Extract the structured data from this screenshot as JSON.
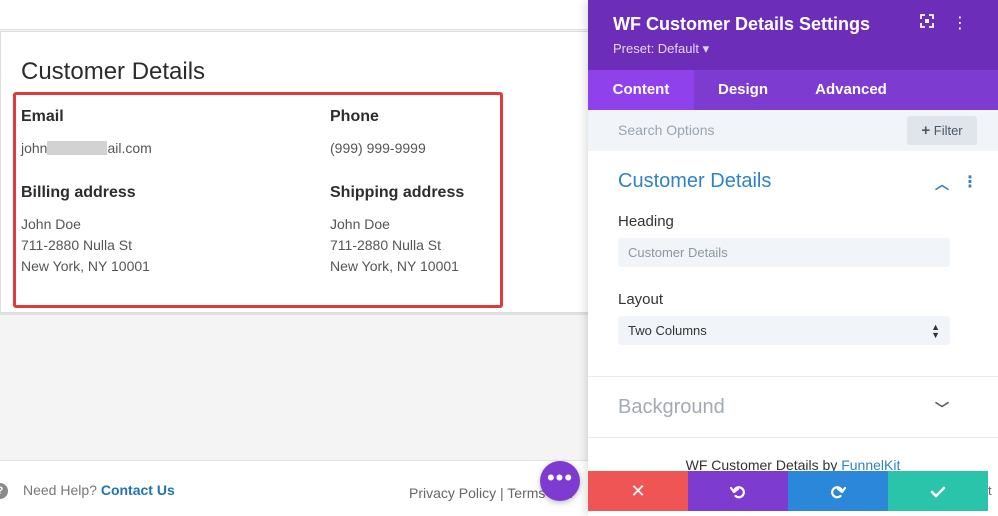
{
  "preview": {
    "title": "Customer Details",
    "email": {
      "label": "Email",
      "value_prefix": "john",
      "value_suffix": "ail.com"
    },
    "phone": {
      "label": "Phone",
      "value": "(999) 999-9999"
    },
    "billing": {
      "label": "Billing address",
      "lines": [
        "John Doe",
        "711-2880 Nulla St",
        "New York, NY 10001"
      ]
    },
    "shipping": {
      "label": "Shipping address",
      "lines": [
        "John Doe",
        "711-2880 Nulla St",
        "New York, NY 10001"
      ]
    }
  },
  "footer": {
    "help_text": "Need Help?",
    "help_link": "Contact Us",
    "policy": "Privacy Policy | Terms and",
    "edge": "t"
  },
  "panel": {
    "title": "WF Customer Details Settings",
    "preset": "Preset: Default ▾",
    "tabs": [
      {
        "label": "Content"
      },
      {
        "label": "Design"
      },
      {
        "label": "Advanced"
      }
    ],
    "search_placeholder": "Search Options",
    "filter_label": "Filter",
    "section_title": "Customer Details",
    "heading_label": "Heading",
    "heading_value": "Customer Details",
    "layout_label": "Layout",
    "layout_value": "Two Columns",
    "background_title": "Background",
    "credit_prefix": "WF Customer Details by ",
    "credit_link": "FunnelKit"
  },
  "colors": {
    "header": "#6c2eb9",
    "tabs": "#7e3bd0",
    "active_tab": "#8f42ec",
    "cancel": "#ef5555",
    "undo": "#7e3bd0",
    "redo": "#2b87da",
    "save": "#29c4a9",
    "highlight": "#e03a3a",
    "link": "#2f83c7"
  }
}
